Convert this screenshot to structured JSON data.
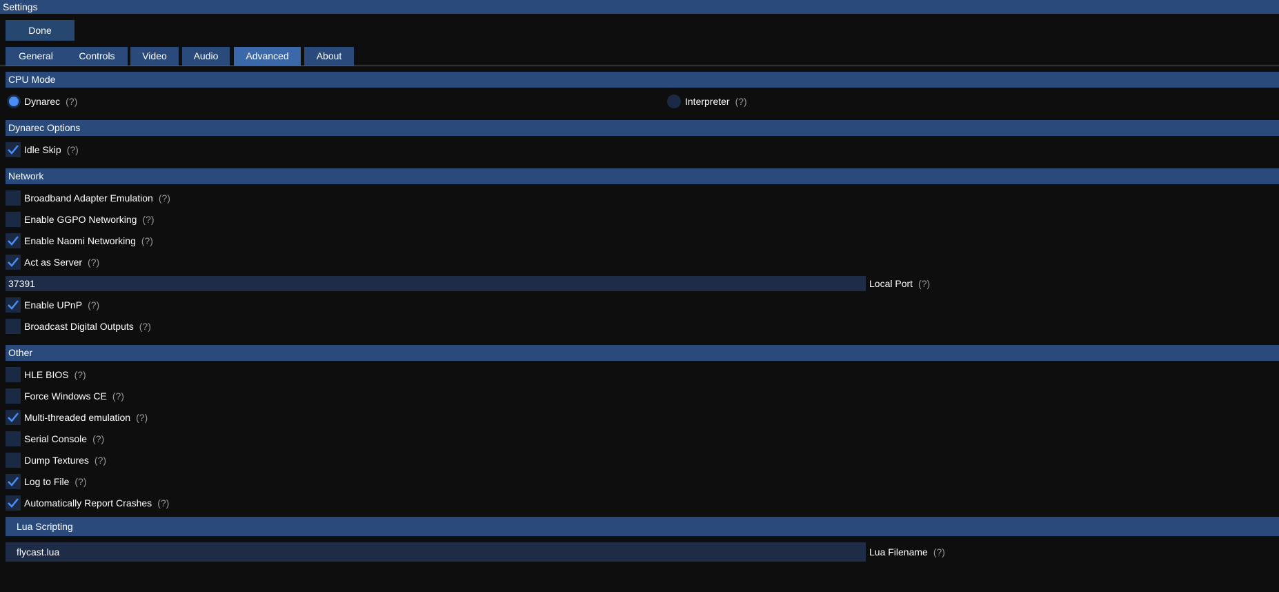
{
  "window": {
    "title": "Settings"
  },
  "toolbar": {
    "done_label": "Done"
  },
  "tabs": [
    {
      "label": "General",
      "active": false
    },
    {
      "label": "Controls",
      "active": false
    },
    {
      "label": "Video",
      "active": false
    },
    {
      "label": "Audio",
      "active": false
    },
    {
      "label": "Advanced",
      "active": true
    },
    {
      "label": "About",
      "active": false
    }
  ],
  "help_text": "(?)",
  "cpu_mode": {
    "header": "CPU Mode",
    "options": [
      {
        "label": "Dynarec",
        "selected": true
      },
      {
        "label": "Interpreter",
        "selected": false
      }
    ]
  },
  "dynarec_options": {
    "header": "Dynarec Options",
    "idle_skip": {
      "label": "Idle Skip",
      "checked": true
    }
  },
  "network": {
    "header": "Network",
    "broadband": {
      "label": "Broadband Adapter Emulation",
      "checked": false
    },
    "ggpo": {
      "label": "Enable GGPO Networking",
      "checked": false
    },
    "naomi": {
      "label": "Enable Naomi Networking",
      "checked": true
    },
    "server": {
      "label": "Act as Server",
      "checked": true
    },
    "local_port": {
      "label": "Local Port",
      "value": "37391"
    },
    "upnp": {
      "label": "Enable UPnP",
      "checked": true
    },
    "digital_outputs": {
      "label": "Broadcast Digital Outputs",
      "checked": false
    }
  },
  "other": {
    "header": "Other",
    "hle_bios": {
      "label": "HLE BIOS",
      "checked": false
    },
    "force_wince": {
      "label": "Force Windows CE",
      "checked": false
    },
    "multithreaded": {
      "label": "Multi-threaded emulation",
      "checked": true
    },
    "serial_console": {
      "label": "Serial Console",
      "checked": false
    },
    "dump_textures": {
      "label": "Dump Textures",
      "checked": false
    },
    "log_to_file": {
      "label": "Log to File",
      "checked": true
    },
    "report_crashes": {
      "label": "Automatically Report Crashes",
      "checked": true
    }
  },
  "lua": {
    "header": "Lua Scripting",
    "filename": {
      "label": "Lua Filename",
      "value": "flycast.lua"
    }
  },
  "colors": {
    "section_bg": "#294a7a",
    "active_tab": "#3b68a8",
    "checkbox_bg": "#1b2a44",
    "check_mark": "#4a8ef5",
    "background": "#0e0e0f"
  }
}
